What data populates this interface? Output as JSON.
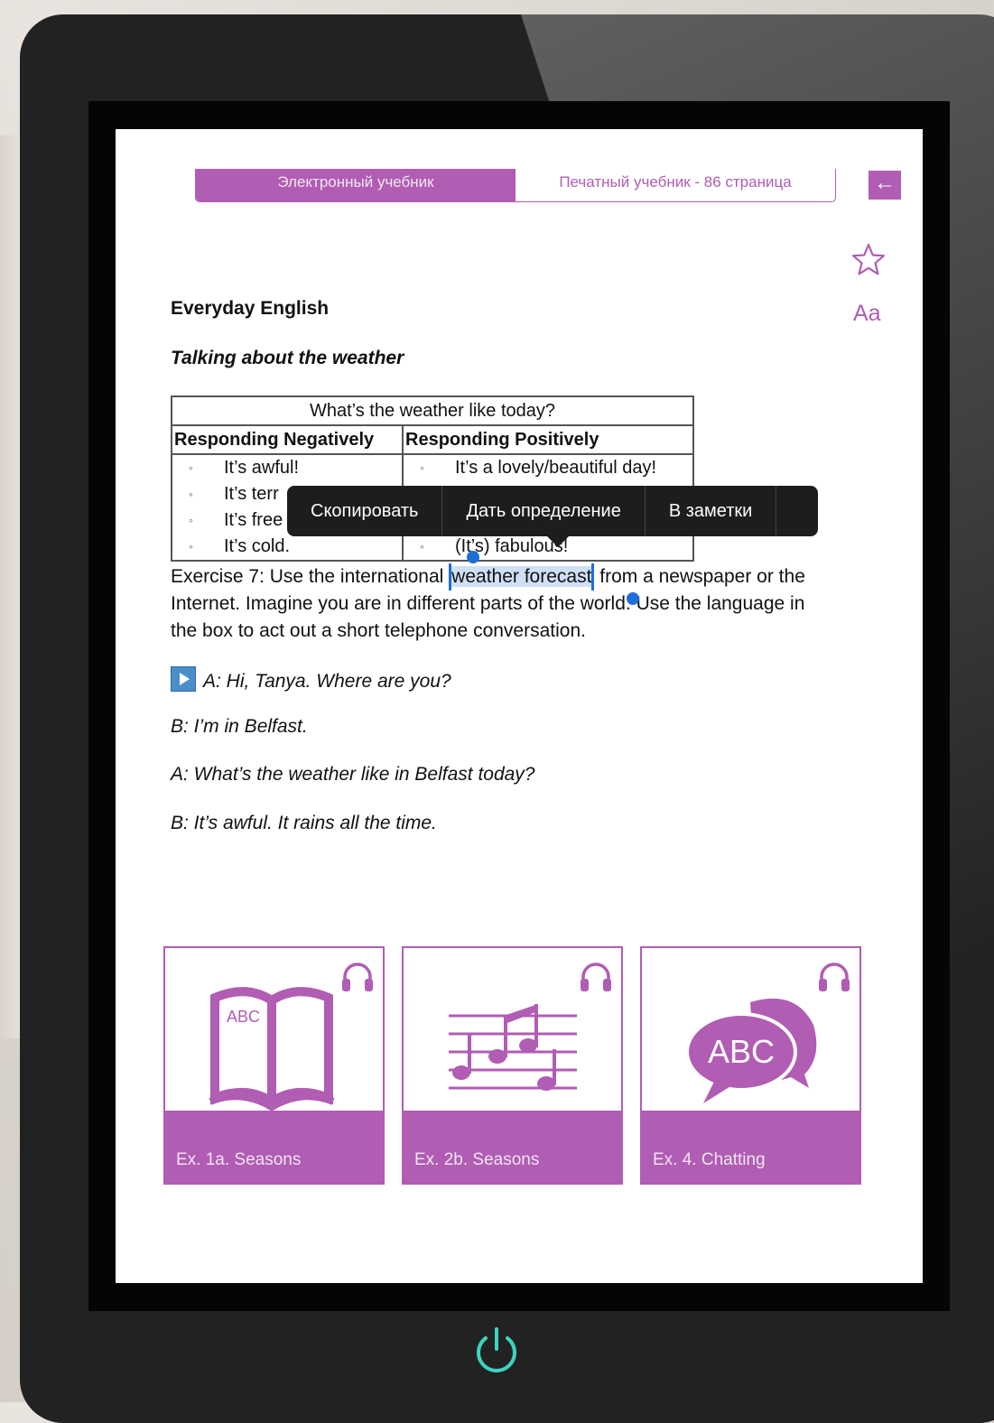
{
  "tabs": {
    "ebook_label": "Электронный учебник",
    "print_label": "Печатный учебник - 86 страница"
  },
  "icons": {
    "back": "arrow-left-icon",
    "favorite": "star-icon",
    "font": "font-size-icon",
    "audio": "headphones-icon",
    "power": "power-icon"
  },
  "font_button_label": "Aa",
  "section_title": "Everyday English",
  "section_subtitle": "Talking about the weather",
  "weather_table": {
    "caption": "What’s the weather like today?",
    "negative_header": "Responding Negatively",
    "positive_header": "Responding Positively",
    "negative_items": [
      "It’s awful!",
      "It’s terr",
      "It’s free",
      "It’s cold."
    ],
    "positive_items": [
      "It’s a lovely/beautiful day!",
      "(It’s) fabulous!"
    ]
  },
  "exercise": {
    "before": "Exercise 7: Use the international ",
    "selected": "weather forecast",
    "after": " from a newspaper or the Internet. Imagine you are in different parts of the world. Use the language in the box to act out a short telephone conversation."
  },
  "context_menu": {
    "copy": "Скопировать",
    "define": "Дать определение",
    "notes": "В заметки"
  },
  "dialogue": [
    "A: Hi, Tanya. Where are you?",
    "B: I’m in Belfast.",
    "A: What’s the weather like in Belfast today?",
    "B: It’s awful. It rains all the time."
  ],
  "tiles": [
    {
      "label": "Ex. 1a. Seasons",
      "art_text": "ABC",
      "icon": "open-book-icon"
    },
    {
      "label": "Ex. 2b. Seasons",
      "icon": "music-notes-icon"
    },
    {
      "label": "Ex. 4. Chatting",
      "art_text": "ABC",
      "icon": "speech-bubbles-icon"
    }
  ],
  "colors": {
    "accent": "#b05db3",
    "selection": "#cfe0f6",
    "selection_handle": "#1f6fd8",
    "power_glow": "#3dd3c0"
  }
}
